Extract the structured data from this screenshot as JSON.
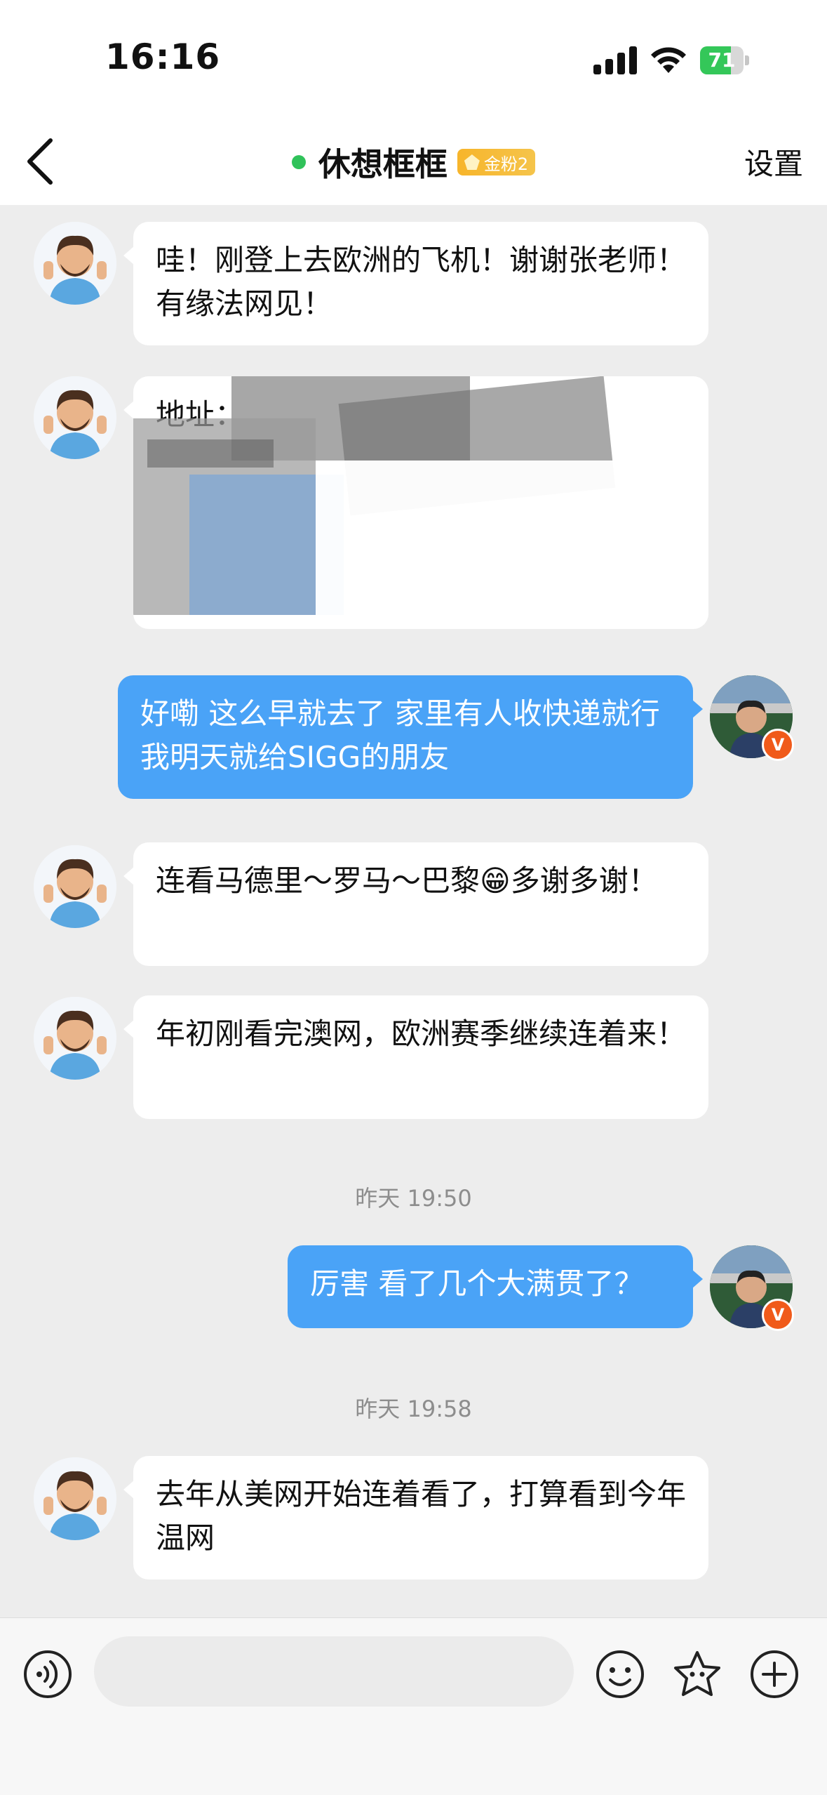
{
  "status_bar": {
    "time": "16:16",
    "battery": "71",
    "battery_level": 0.71
  },
  "nav": {
    "back_icon": "chevron-left-icon",
    "title": "休想框框",
    "badge_text": "金粉2",
    "settings_label": "设置"
  },
  "messages": [
    {
      "side": "in",
      "text": "哇！刚登上去欧洲的飞机！谢谢张老师！有缘法网见！"
    },
    {
      "side": "in",
      "text": "地址：",
      "redacted": true
    },
    {
      "side": "out",
      "text": "好嘞 这么早就去了 家里有人收快递就行 我明天就给SIGG的朋友"
    },
    {
      "side": "in",
      "text": "连看马德里～罗马～巴黎😁多谢多谢！"
    },
    {
      "side": "in",
      "text": "年初刚看完澳网，欧洲赛季继续连着来！"
    },
    {
      "timestamp": "昨天 19:50"
    },
    {
      "side": "out",
      "text": "厉害 看了几个大满贯了？"
    },
    {
      "timestamp": "昨天 19:58"
    },
    {
      "side": "in",
      "text": "去年从美网开始连着看了，打算看到今年温网"
    }
  ],
  "verified_badge": "V",
  "input_bar": {
    "voice_icon": "voice-icon",
    "placeholder": "",
    "emoji_icon": "emoji-icon",
    "sticker_icon": "sticker-icon",
    "add_icon": "plus-icon"
  }
}
